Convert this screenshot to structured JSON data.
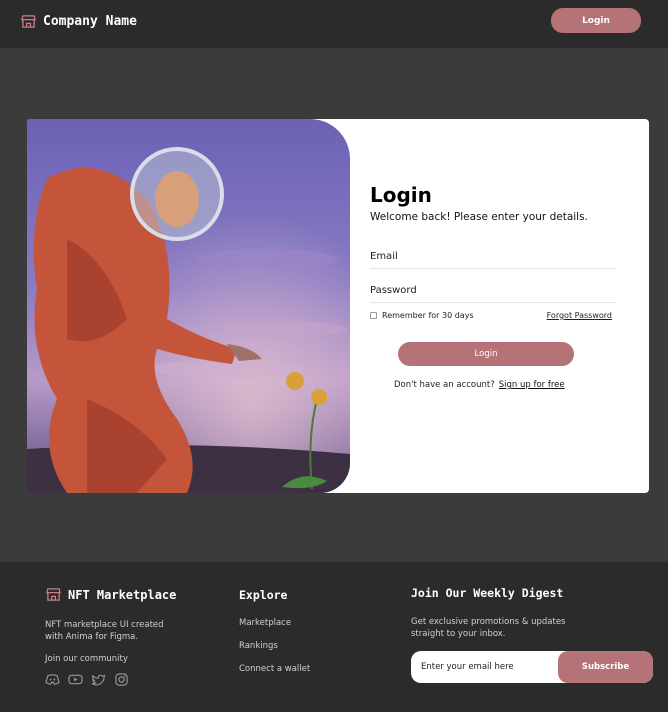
{
  "header": {
    "brand_name": "Company Name",
    "login_label": "Login"
  },
  "login_card": {
    "title": "Login",
    "subtitle": "Welcome back! Please enter your details.",
    "email_label": "Email",
    "password_label": "Password",
    "remember_label": "Remember for 30 days",
    "forgot_label": "Forgot Password",
    "login_label": "Login",
    "no_account_text": "Don't have an account?",
    "signup_label": "Sign up for free"
  },
  "footer": {
    "brand_name": "NFT Marketplace",
    "description": "NFT marketplace UI created with Anima for Figma.",
    "community_label": "Join our community",
    "socials": [
      "discord-icon",
      "youtube-icon",
      "twitter-icon",
      "instagram-icon"
    ],
    "explore_title": "Explore",
    "explore_links": [
      "Marketplace",
      "Rankings",
      "Connect a wallet"
    ],
    "digest_title": "Join Our Weekly Digest",
    "digest_description": "Get exclusive promotions & updates straight to your inbox.",
    "email_placeholder": "Enter your email here",
    "subscribe_label": "Subscribe"
  },
  "colors": {
    "accent": "#b57378",
    "page_bg": "#3b3b3b",
    "bar_bg": "#2b2b2b"
  }
}
